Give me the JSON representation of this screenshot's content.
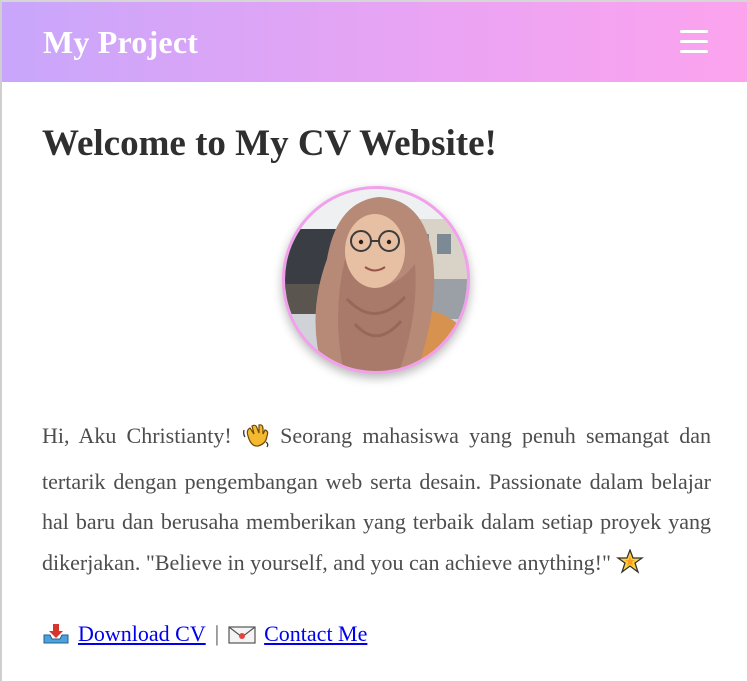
{
  "navbar": {
    "brand": "My Project",
    "menu_icon": "hamburger-menu-icon",
    "gradient_start": "#c8a6fb",
    "gradient_end": "#fca3ee"
  },
  "main": {
    "heading": "Welcome to My CV Website!",
    "avatar": {
      "image": "profile-photo",
      "border_color": "#f2a0ec"
    },
    "bio": {
      "greeting": "Hi, Aku Christianty!",
      "wave_icon": "waving-hand-emoji",
      "text": "Seorang mahasiswa yang penuh semangat dan tertarik dengan pengembangan web serta desain. Passionate dalam belajar hal baru dan berusaha memberikan yang terbaik dalam setiap proyek yang dikerjakan. \"Believe in yourself, and you can achieve anything!\"",
      "sparkle_icon": "glowing-star-emoji"
    },
    "links": {
      "download_icon": "inbox-tray-emoji",
      "download_label": "Download CV",
      "separator": "|",
      "contact_icon": "envelope-emoji",
      "contact_label": "Contact Me",
      "link_color": "#0000ee"
    }
  }
}
